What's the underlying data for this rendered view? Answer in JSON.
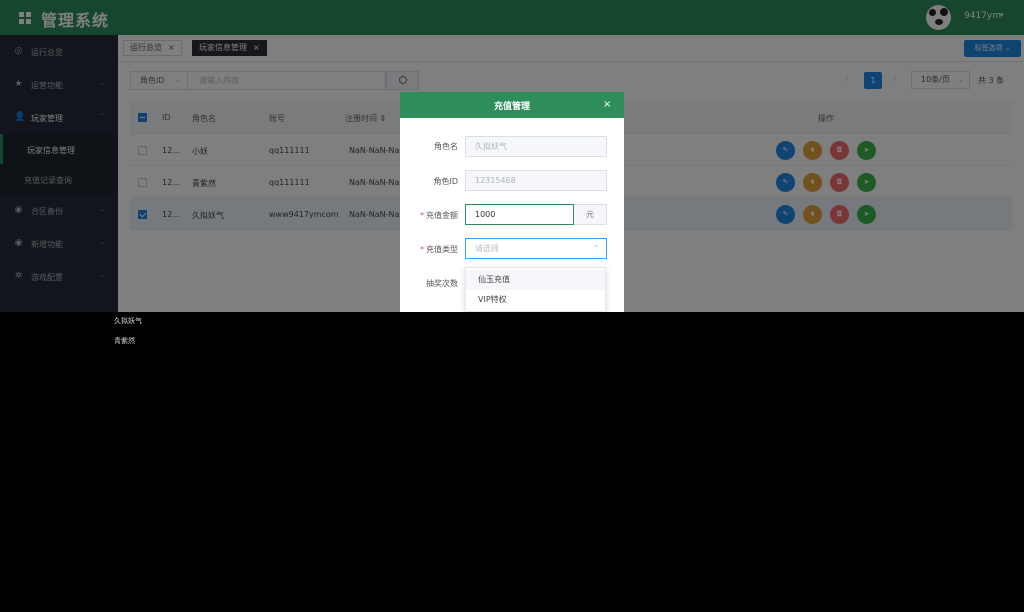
{
  "header": {
    "title": "管理系统",
    "user": "9417ym",
    "caret": "▾"
  },
  "sidebar": {
    "items": [
      {
        "label": "运行总览",
        "icon": "◎",
        "chevron": ""
      },
      {
        "label": "运营功能",
        "icon": "★",
        "chevron": "⌄"
      },
      {
        "label": "玩家管理",
        "icon": "👤",
        "chevron": "⌃"
      },
      {
        "label": "合区备份",
        "icon": "◉",
        "chevron": "⌄"
      },
      {
        "label": "新增功能",
        "icon": "◉",
        "chevron": "⌄"
      },
      {
        "label": "游戏配置",
        "icon": "✲",
        "chevron": "⌄"
      }
    ],
    "sub_items": [
      {
        "label": "玩家信息管理"
      },
      {
        "label": "充值记录查询"
      }
    ]
  },
  "tags": [
    {
      "label": "运行总览",
      "close": "×"
    },
    {
      "label": "玩家信息管理",
      "close": "×"
    }
  ],
  "tag_options": {
    "label": "标签选项 ⌄"
  },
  "toolbar": {
    "field_select": "角色ID",
    "search_placeholder": "请输入内容",
    "chevron": "⌄"
  },
  "pagination": {
    "prev": "‹",
    "page": "1",
    "next": "›",
    "page_size": "10条/页",
    "total": "共 3 条"
  },
  "table": {
    "columns": [
      "ID",
      "角色名",
      "账号",
      "注册时间 ⇕",
      "操作"
    ],
    "rows": [
      {
        "id": "12...",
        "name": "小妖",
        "account": "qq111111",
        "reg_time": "NaN-NaN-NaN",
        "checked": false
      },
      {
        "id": "12...",
        "name": "青紫然",
        "account": "qq111111",
        "reg_time": "NaN-NaN-NaN",
        "checked": false
      },
      {
        "id": "12...",
        "name": "久拟妖气",
        "account": "www9417ymcom",
        "reg_time": "NaN-NaN-NaN",
        "checked": true
      }
    ],
    "actions": [
      {
        "name": "edit",
        "icon": "✎",
        "color": "#1e88e5"
      },
      {
        "name": "gift",
        "icon": "♦",
        "color": "#e6a23c"
      },
      {
        "name": "lock",
        "icon": "◘",
        "color": "#f56c6c"
      },
      {
        "name": "send",
        "icon": "➤",
        "color": "#3bb54a"
      }
    ]
  },
  "dialog": {
    "title": "充值管理",
    "close": "×",
    "fields": {
      "role_name": {
        "label": "角色名",
        "value": "久拟妖气"
      },
      "role_id": {
        "label": "角色ID",
        "value": "12315468"
      },
      "amount": {
        "label": "充值金额",
        "value": "1000",
        "unit": "元",
        "required": "*"
      },
      "type": {
        "label": "充值类型",
        "placeholder": "请选择",
        "required": "*",
        "chevron": "⌃"
      },
      "lottery": {
        "label": "抽奖次数"
      }
    },
    "dropdown_options": [
      "仙玉充值",
      "VIP特权"
    ]
  },
  "artifacts": [
    "久拟妖气",
    "青紫然"
  ],
  "colors": {
    "primary_green": "#2f8d5c",
    "sidebar_bg": "#252b36",
    "accent_blue": "#1e88e5"
  }
}
